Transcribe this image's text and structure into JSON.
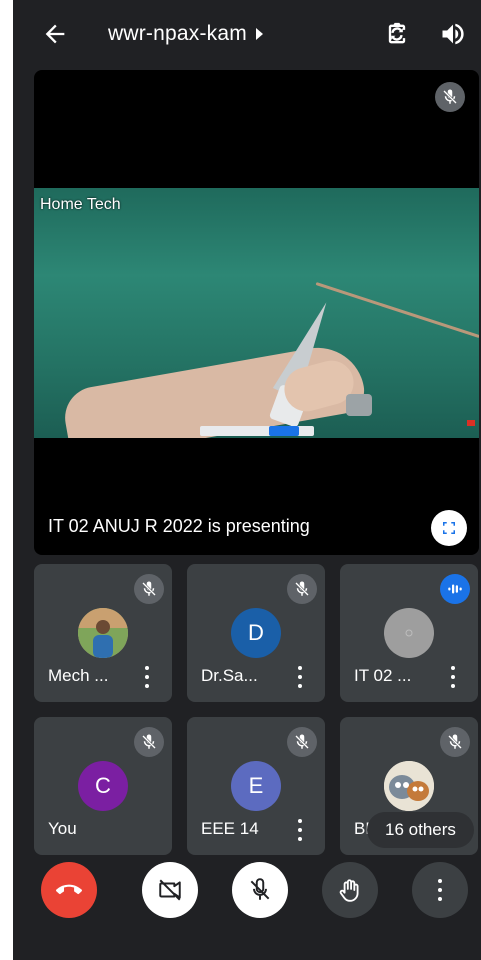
{
  "header": {
    "meeting_code": "wwr-npax-kam"
  },
  "presentation": {
    "video_label": "Home Tech",
    "presenting_text": "IT 02 ANUJ R 2022 is presenting"
  },
  "participants": [
    {
      "name": "Mech ...",
      "avatar_type": "photo",
      "mic": "muted"
    },
    {
      "name": "Dr.Sa...",
      "avatar_letter": "D",
      "avatar_color": "#1a5fa8",
      "mic": "muted"
    },
    {
      "name": "IT 02 ...",
      "avatar_type": "grey",
      "avatar_color": "#9e9e9e",
      "mic": "speaking"
    },
    {
      "name": "You",
      "avatar_letter": "C",
      "avatar_color": "#7b1fa2",
      "mic": "muted"
    },
    {
      "name": "EEE 14",
      "avatar_letter": "E",
      "avatar_color": "#5c6bc0",
      "mic": "muted"
    },
    {
      "name": "BMT 085",
      "avatar_type": "cartoon",
      "mic": "muted",
      "others_label": "16 others"
    }
  ],
  "controls": {
    "end_call_color": "#ea4335",
    "accent": "#1a73e8"
  },
  "icons": [
    "back-arrow-icon",
    "chevron-right-icon",
    "camera-flip-icon",
    "speaker-icon",
    "mic-off-icon",
    "fullscreen-icon",
    "speaking-icon",
    "more-vert-icon",
    "phone-hangup-icon",
    "video-off-icon",
    "raise-hand-icon"
  ]
}
